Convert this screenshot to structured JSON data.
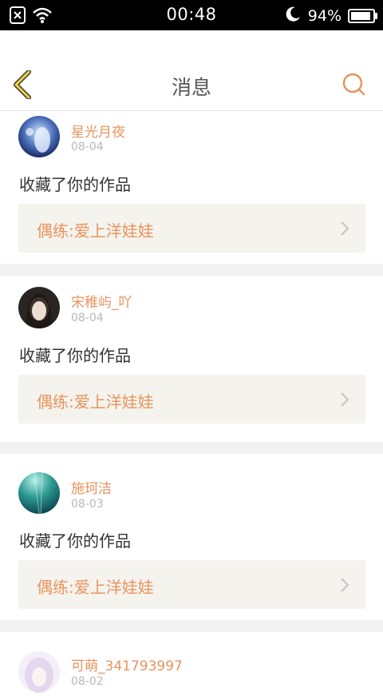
{
  "status_bar": {
    "time": "00:48",
    "battery": "94%",
    "battery_level": 0.94
  },
  "header": {
    "title": "消息",
    "accent_color": "#e8945e"
  },
  "messages": [
    {
      "user": "星光月夜",
      "date": "08-04",
      "action": "收藏了你的作品",
      "work": "偶练:爱上洋娃娃"
    },
    {
      "user": "宋稚屿_吖",
      "date": "08-04",
      "action": "收藏了你的作品",
      "work": "偶练:爱上洋娃娃"
    },
    {
      "user": "施珂洁",
      "date": "08-03",
      "action": "收藏了你的作品",
      "work": "偶练:爱上洋娃娃"
    },
    {
      "user": "可萌_341793997",
      "date": "08-02"
    }
  ]
}
